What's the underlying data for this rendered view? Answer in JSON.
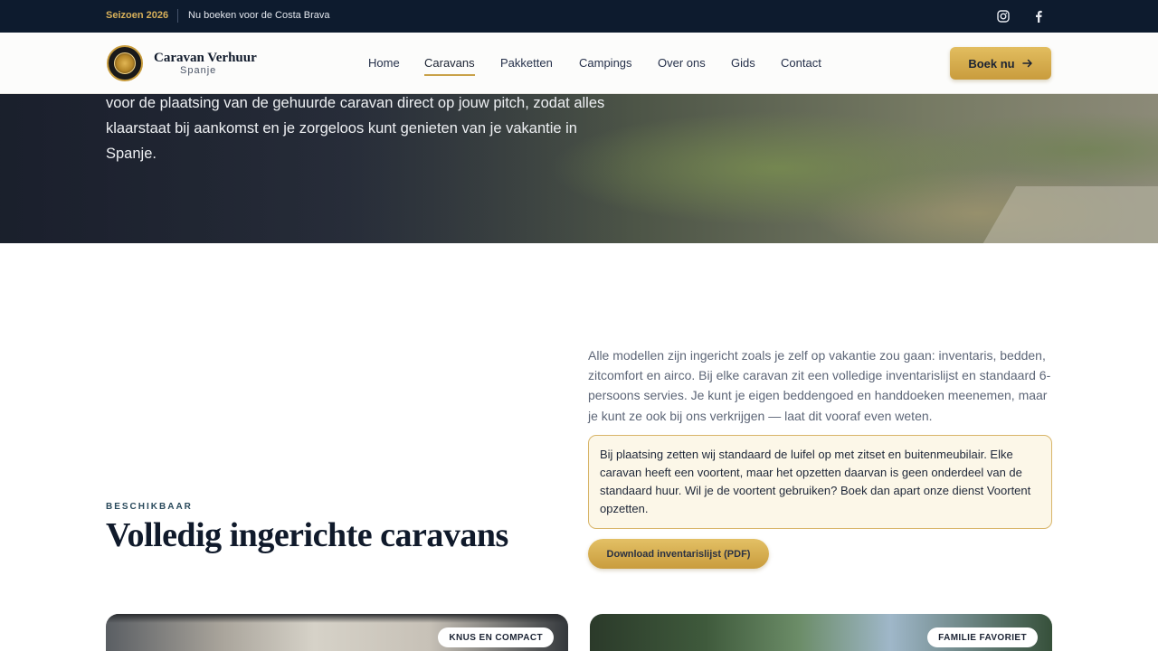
{
  "topbar": {
    "season": "Seizoen 2026",
    "promo": "Nu boeken voor de Costa Brava",
    "social": [
      "instagram-icon",
      "facebook-icon"
    ]
  },
  "header": {
    "brand_name": "Caravan Verhuur",
    "brand_sub": "Spanje",
    "nav": [
      {
        "label": "Home",
        "active": false
      },
      {
        "label": "Caravans",
        "active": true
      },
      {
        "label": "Pakketten",
        "active": false
      },
      {
        "label": "Campings",
        "active": false
      },
      {
        "label": "Over ons",
        "active": false
      },
      {
        "label": "Gids",
        "active": false
      },
      {
        "label": "Contact",
        "active": false
      }
    ],
    "cta_label": "Boek nu",
    "cta_icon": "arrow-right-icon"
  },
  "hero": {
    "text": "voor de plaatsing van de gehuurde caravan direct op jouw pitch, zodat alles klaarstaat bij aankomst en je zorgeloos kunt genieten van je vakantie in Spanje."
  },
  "section": {
    "eyebrow": "BESCHIKBAAR",
    "title": "Volledig ingerichte caravans",
    "intro": "Alle modellen zijn ingericht zoals je zelf op vakantie zou gaan: inventaris, bedden, zitcomfort en airco. Bij elke caravan zit een volledige inventarislijst en standaard 6-persoons servies. Je kunt je eigen beddengoed en handdoeken meenemen, maar je kunt ze ook bij ons verkrijgen — laat dit vooraf even weten.",
    "notice": "Bij plaatsing zetten wij standaard de luifel op met zitset en buitenmeubilair. Elke caravan heeft een voortent, maar het opzetten daarvan is geen onderdeel van de standaard huur. Wil je de voortent gebruiken? Boek dan apart onze dienst Voortent opzetten.",
    "download_label": "Download inventarislijst (PDF)"
  },
  "cards": [
    {
      "badge": "KNUS EN COMPACT"
    },
    {
      "badge": "FAMILIE FAVORIET"
    }
  ],
  "colors": {
    "navy": "#0d1b2e",
    "gold": "#c99c3d",
    "notice_bg": "#fcf7e8"
  }
}
